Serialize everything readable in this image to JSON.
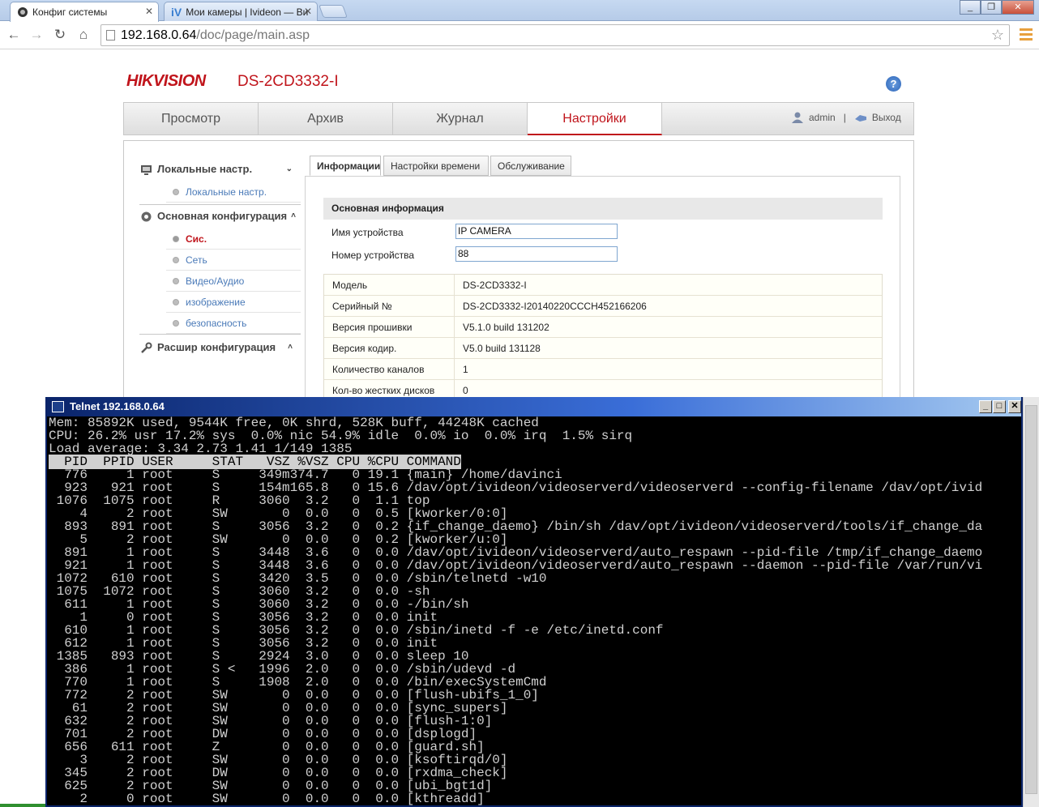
{
  "browser": {
    "tabs": [
      {
        "title": "Конфиг системы",
        "active": true
      },
      {
        "title": "Мои камеры | Ivideon — Ви",
        "active": false
      }
    ],
    "url_host": "192.168.0.64",
    "url_path": "/doc/page/main.asp"
  },
  "header": {
    "brand": "HIKVISION",
    "model": "DS-2CD3332-I",
    "help": "?"
  },
  "nav": {
    "items": [
      "Просмотр",
      "Архив",
      "Журнал",
      "Настройки"
    ],
    "active": "Настройки",
    "user": "admin",
    "separator": "|",
    "logout": "Выход"
  },
  "sidebar": {
    "local_header": "Локальные настр.",
    "local_items": [
      "Локальные настр."
    ],
    "basic_header": "Основная конфигурация",
    "basic_items": [
      "Сис.",
      "Сеть",
      "Видео/Аудио",
      "изображение",
      "безопасность"
    ],
    "active_item": "Сис.",
    "advanced_header": "Расшир конфигурация"
  },
  "subtabs": [
    "Информации",
    "Настройки времени",
    "Обслуживание"
  ],
  "basic_info": {
    "title": "Основная информация",
    "device_name_label": "Имя устройства",
    "device_name_value": "IP CAMERA",
    "device_number_label": "Номер устройства",
    "device_number_value": "88",
    "rows": [
      {
        "k": "Модель",
        "v": "DS-2CD3332-I"
      },
      {
        "k": "Серийный №",
        "v": "DS-2CD3332-I20140220CCCH452166206"
      },
      {
        "k": "Версия прошивки",
        "v": "V5.1.0 build 131202"
      },
      {
        "k": "Версия кодир.",
        "v": "V5.0 build 131128"
      },
      {
        "k": "Количество каналов",
        "v": "1"
      },
      {
        "k": "Кол-во жестких дисков",
        "v": "0"
      }
    ]
  },
  "telnet": {
    "title": "Telnet 192.168.0.64",
    "lines": [
      "Mem: 85892K used, 9544K free, 0K shrd, 528K buff, 44248K cached",
      "CPU: 26.2% usr 17.2% sys  0.0% nic 54.9% idle  0.0% io  0.0% irq  1.5% sirq",
      "Load average: 3.34 2.73 1.41 1/149 1385"
    ],
    "header": "  PID  PPID USER     STAT   VSZ %VSZ CPU %CPU COMMAND",
    "rows": [
      "  776     1 root     S     349m374.7   0 19.1 {main} /home/davinci",
      "  923   921 root     S     154m165.8   0 15.6 /dav/opt/ivideon/videoserverd/videoserverd --config-filename /dav/opt/ivid",
      " 1076  1075 root     R     3060  3.2   0  1.1 top",
      "    4     2 root     SW       0  0.0   0  0.5 [kworker/0:0]",
      "  893   891 root     S     3056  3.2   0  0.2 {if_change_daemo} /bin/sh /dav/opt/ivideon/videoserverd/tools/if_change_da",
      "    5     2 root     SW       0  0.0   0  0.2 [kworker/u:0]",
      "  891     1 root     S     3448  3.6   0  0.0 /dav/opt/ivideon/videoserverd/auto_respawn --pid-file /tmp/if_change_daemo",
      "  921     1 root     S     3448  3.6   0  0.0 /dav/opt/ivideon/videoserverd/auto_respawn --daemon --pid-file /var/run/vi",
      " 1072   610 root     S     3420  3.5   0  0.0 /sbin/telnetd -w10",
      " 1075  1072 root     S     3060  3.2   0  0.0 -sh",
      "  611     1 root     S     3060  3.2   0  0.0 -/bin/sh",
      "    1     0 root     S     3056  3.2   0  0.0 init",
      "  610     1 root     S     3056  3.2   0  0.0 /sbin/inetd -f -e /etc/inetd.conf",
      "  612     1 root     S     3056  3.2   0  0.0 init",
      " 1385   893 root     S     2924  3.0   0  0.0 sleep 10",
      "  386     1 root     S <   1996  2.0   0  0.0 /sbin/udevd -d",
      "  770     1 root     S     1908  2.0   0  0.0 /bin/execSystemCmd",
      "  772     2 root     SW       0  0.0   0  0.0 [flush-ubifs_1_0]",
      "   61     2 root     SW       0  0.0   0  0.0 [sync_supers]",
      "  632     2 root     SW       0  0.0   0  0.0 [flush-1:0]",
      "  701     2 root     DW       0  0.0   0  0.0 [dsplogd]",
      "  656   611 root     Z        0  0.0   0  0.0 [guard.sh]",
      "    3     2 root     SW       0  0.0   0  0.0 [ksoftirqd/0]",
      "  345     2 root     DW       0  0.0   0  0.0 [rxdma_check]",
      "  625     2 root     SW       0  0.0   0  0.0 [ubi_bgt1d]",
      "    2     0 root     SW       0  0.0   0  0.0 [kthreadd]"
    ]
  }
}
